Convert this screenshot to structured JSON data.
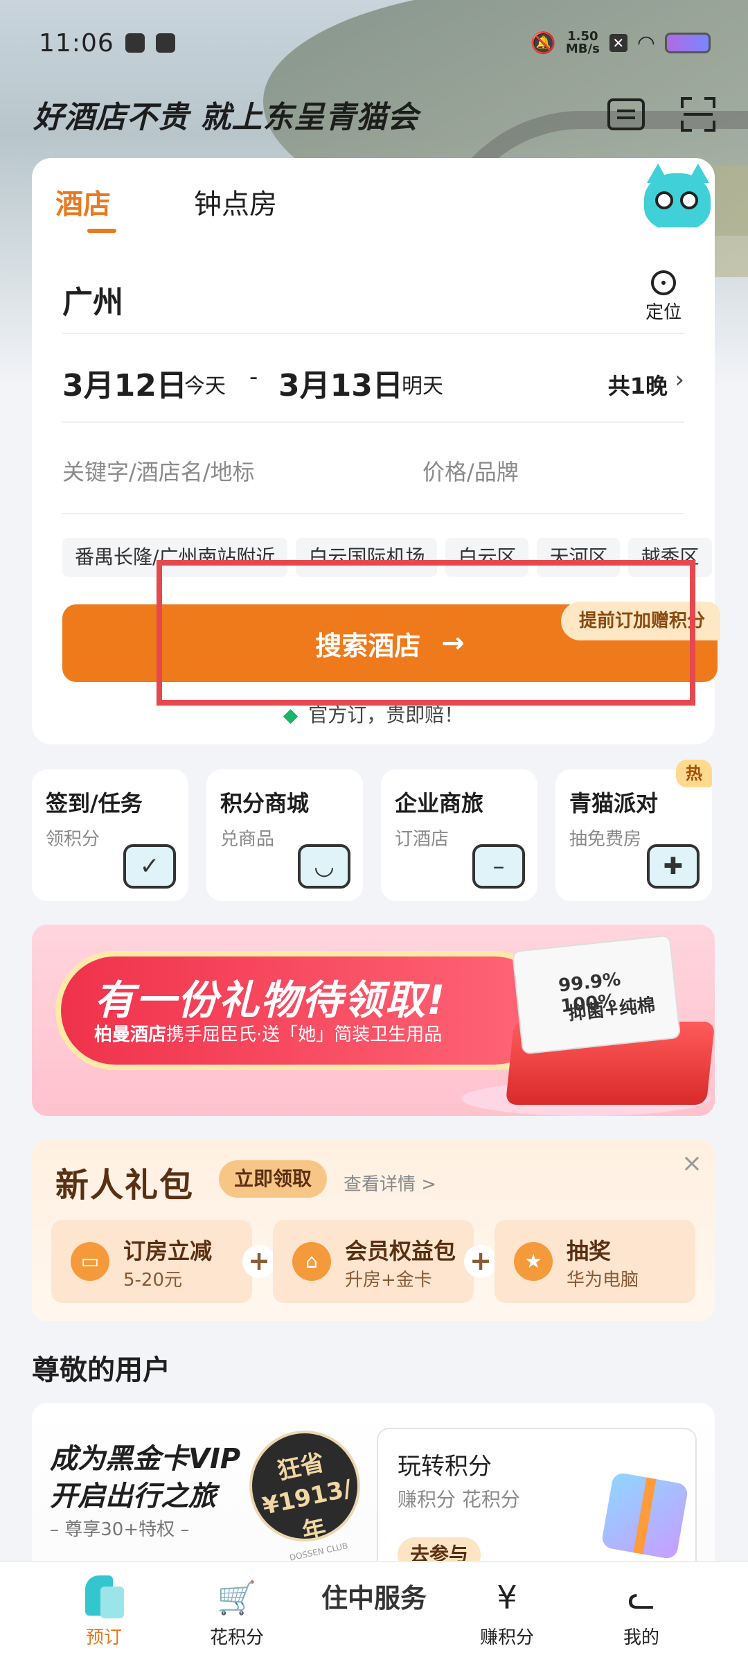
{
  "status_bar": {
    "time": "11:06",
    "network_speed_value": "1.50",
    "network_speed_unit": "MB/s"
  },
  "header": {
    "slogan": "好酒店不贵 就上东呈青猫会"
  },
  "search": {
    "tabs": [
      {
        "label": "酒店",
        "active": true
      },
      {
        "label": "钟点房",
        "active": false
      }
    ],
    "city": "广州",
    "locate_label": "定位",
    "checkin_date": "3月12日",
    "checkin_sub": "今天",
    "date_separator": "-",
    "checkout_date": "3月13日",
    "checkout_sub": "明天",
    "nights": "共1晚",
    "keyword_placeholder": "关键字/酒店名/地标",
    "price_placeholder": "价格/品牌",
    "tags": [
      "番禺长隆/广州南站附近",
      "白云国际机场",
      "白云区",
      "天河区",
      "越秀区"
    ],
    "search_button": "搜索酒店",
    "bonus_badge": "提前订加赠积分",
    "guarantee": "官方订，贵即赔！"
  },
  "quick_actions": [
    {
      "title": "签到/任务",
      "sub": "领积分",
      "icon": "calendar-check-icon"
    },
    {
      "title": "积分商城",
      "sub": "兑商品",
      "icon": "shopping-bag-icon"
    },
    {
      "title": "企业商旅",
      "sub": "订酒店",
      "icon": "briefcase-icon"
    },
    {
      "title": "青猫派对",
      "sub": "抽免费房",
      "icon": "gamepad-icon",
      "badge": "热"
    }
  ],
  "banner": {
    "title": "有一份礼物待领取!",
    "brand": "柏曼酒店",
    "subtitle": "携手屈臣氏·送「她」简装卫生用品",
    "product_line1": "99.9% 100%",
    "product_line2": "抑菌+纯棉"
  },
  "newbie_pack": {
    "title": "新人礼包",
    "claim_button": "立即领取",
    "detail_link": "查看详情 >",
    "items": [
      {
        "title": "订房立减",
        "sub": "5-20元"
      },
      {
        "title": "会员权益包",
        "sub": "升房+金卡"
      },
      {
        "title": "抽奖",
        "sub": "华为电脑"
      }
    ]
  },
  "user_section": {
    "title": "尊敬的用户",
    "vip_line1": "成为黑金卡VIP",
    "vip_line2": "开启出行之旅",
    "vip_line3": "– 尊享30+特权 –",
    "seal_line1": "狂省",
    "seal_line2": "¥1913/年",
    "seal_line3": "DOSSEN CLUB",
    "points_title": "玩转积分",
    "points_sub": "赚积分 花积分",
    "points_button": "去参与"
  },
  "bottom_nav": [
    {
      "label": "预订",
      "active": true
    },
    {
      "label": "花积分",
      "active": false
    },
    {
      "label": "住中服务",
      "active": false
    },
    {
      "label": "赚积分",
      "active": false
    },
    {
      "label": "我的",
      "active": false
    }
  ],
  "colors": {
    "accent_orange": "#ef7a1c",
    "highlight_red": "#e5484d",
    "guarantee_green": "#18b66a"
  }
}
